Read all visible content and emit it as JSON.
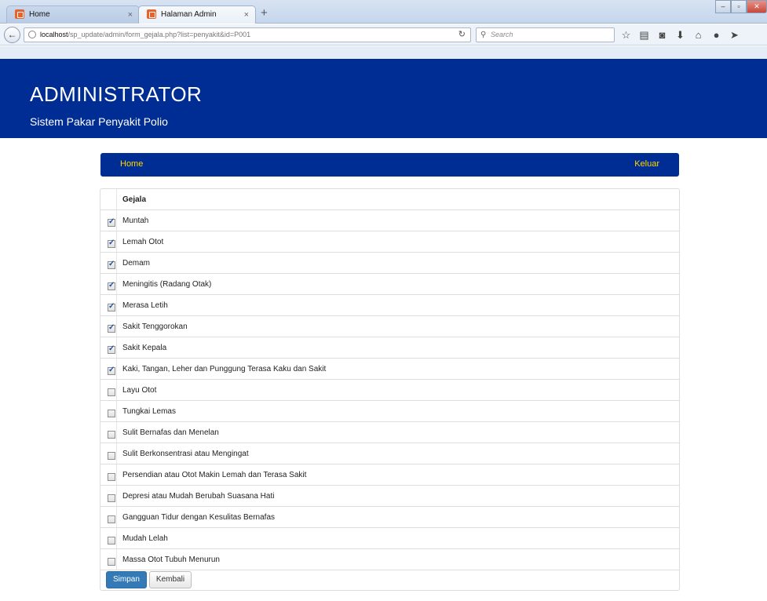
{
  "browser": {
    "tabs": [
      {
        "label": "Home",
        "active": false
      },
      {
        "label": "Halaman Admin",
        "active": true
      }
    ],
    "new_tab_symbol": "+",
    "close_symbol": "×",
    "url_host": "localhost",
    "url_path": "/sp_update/admin/form_gejala.php?list=penyakit&id=P001",
    "search_placeholder": "Search",
    "toolbar_icons": [
      "star-icon",
      "reading-list-icon",
      "pocket-icon",
      "download-icon",
      "home-icon",
      "chat-icon",
      "send-icon"
    ]
  },
  "header": {
    "title": "ADMINISTRATOR",
    "subtitle": "Sistem Pakar Penyakit Polio",
    "background": "#002d93"
  },
  "menu": {
    "home_label": "Home",
    "logout_label": "Keluar",
    "link_color": "#ffd700"
  },
  "table": {
    "header": "Gejala",
    "rows": [
      {
        "label": "Muntah",
        "checked": true
      },
      {
        "label": "Lemah Otot",
        "checked": true
      },
      {
        "label": "Demam",
        "checked": true
      },
      {
        "label": "Meningitis (Radang Otak)",
        "checked": true
      },
      {
        "label": "Merasa Letih",
        "checked": true
      },
      {
        "label": "Sakit Tenggorokan",
        "checked": true
      },
      {
        "label": "Sakit Kepala",
        "checked": true
      },
      {
        "label": "Kaki, Tangan, Leher dan Punggung Terasa Kaku dan Sakit",
        "checked": true
      },
      {
        "label": "Layu Otot",
        "checked": false
      },
      {
        "label": "Tungkai Lemas",
        "checked": false
      },
      {
        "label": "Sulit Bernafas dan Menelan",
        "checked": false
      },
      {
        "label": "Sulit Berkonsentrasi atau Mengingat",
        "checked": false
      },
      {
        "label": "Persendian atau Otot Makin Lemah dan Terasa Sakit",
        "checked": false
      },
      {
        "label": "Depresi atau Mudah Berubah Suasana Hati",
        "checked": false
      },
      {
        "label": "Gangguan Tidur dengan Kesulitas Bernafas",
        "checked": false
      },
      {
        "label": "Mudah Lelah",
        "checked": false
      },
      {
        "label": "Massa Otot Tubuh Menurun",
        "checked": false
      }
    ]
  },
  "buttons": {
    "save_label": "Simpan",
    "back_label": "Kembali"
  }
}
